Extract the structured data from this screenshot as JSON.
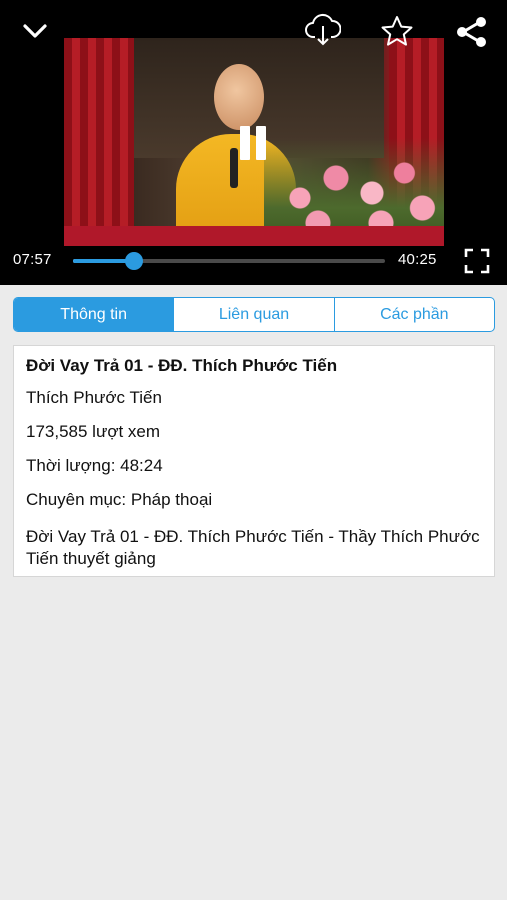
{
  "player": {
    "current_time": "07:57",
    "total_time": "40:25",
    "progress": 0.197,
    "buffered": 0.22,
    "state": "playing",
    "icons": {
      "collapse": "chevron-down-icon",
      "download": "cloud-download-icon",
      "favorite": "star-icon",
      "share": "share-icon",
      "pause": "pause-icon",
      "fullscreen": "fullscreen-icon"
    }
  },
  "tabs": [
    {
      "label": "Thông tin",
      "active": true
    },
    {
      "label": "Liên quan",
      "active": false
    },
    {
      "label": "Các phần",
      "active": false
    }
  ],
  "info": {
    "title": "Đời Vay Trả 01 - ĐĐ. Thích Phước Tiến",
    "author": "Thích Phước Tiến",
    "views": "173,585 lượt xem",
    "duration": "Thời lượng: 48:24",
    "category": "Chuyên mục: Pháp thoại",
    "description": "Đời Vay Trả 01 - ĐĐ. Thích Phước Tiến - Thầy Thích Phước Tiến thuyết giảng"
  },
  "colors": {
    "accent": "#2b9be0",
    "player_bg": "#000000",
    "page_bg": "#ebebeb"
  }
}
